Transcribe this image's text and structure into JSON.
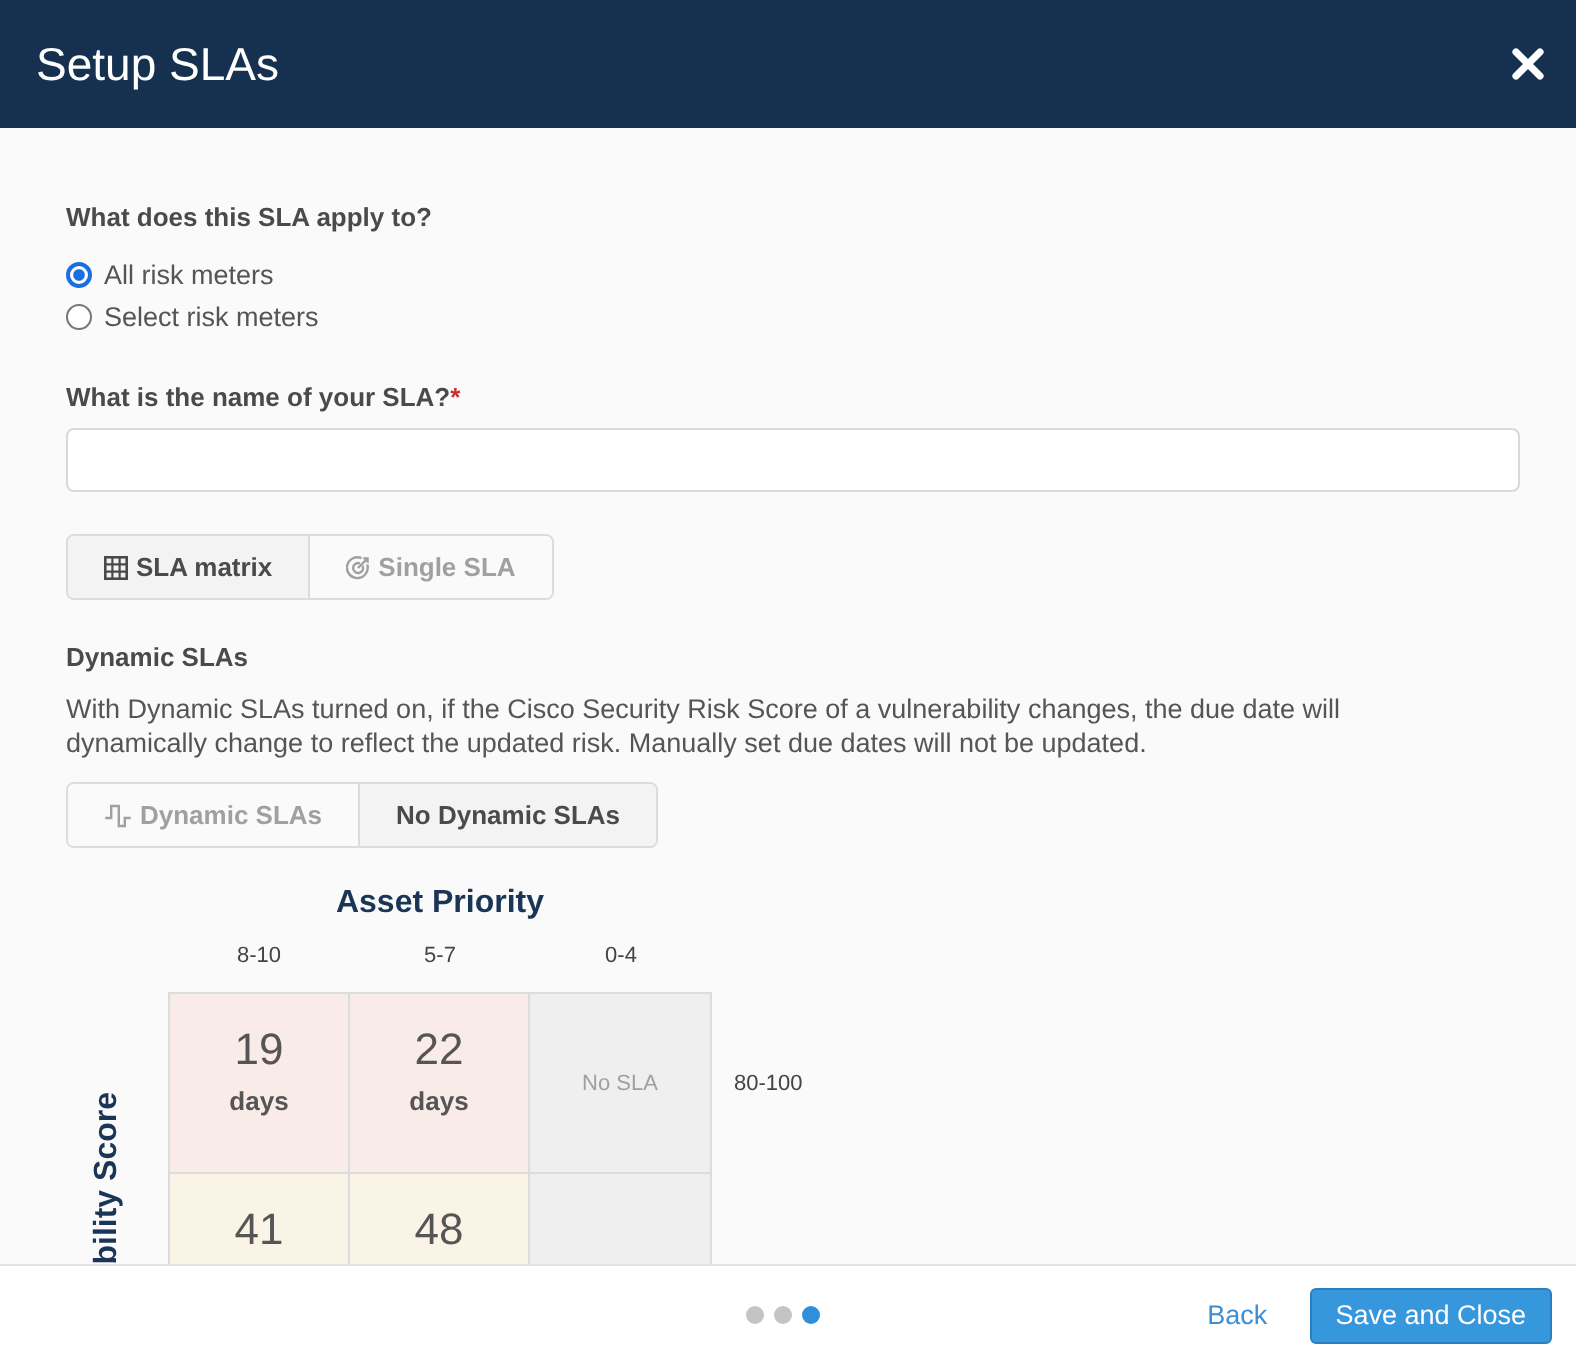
{
  "dialog": {
    "title": "Setup SLAs"
  },
  "apply_to": {
    "label": "What does this SLA apply to?",
    "options": [
      {
        "label": "All risk meters",
        "selected": true
      },
      {
        "label": "Select risk meters",
        "selected": false
      }
    ]
  },
  "sla_name": {
    "label": "What is the name of your SLA?",
    "required_mark": "*"
  },
  "sla_type": [
    {
      "label": "SLA matrix",
      "selected": true
    },
    {
      "label": "Single SLA",
      "selected": false
    }
  ],
  "dynamic_slas": {
    "title": "Dynamic SLAs",
    "description": "With Dynamic SLAs turned on, if the Cisco Security Risk Score of a vulnerability changes, the due date will dynamically change to reflect the updated risk. Manually set due dates will not be updated.",
    "options": [
      {
        "label": "Dynamic SLAs",
        "selected": false
      },
      {
        "label": "No Dynamic SLAs",
        "selected": true
      }
    ]
  },
  "matrix": {
    "column_axis": "Asset Priority",
    "row_axis": "bility Score",
    "columns": [
      "8-10",
      "5-7",
      "0-4"
    ],
    "rows": [
      {
        "label": "80-100",
        "cells": [
          {
            "kind": "days",
            "value": "19",
            "unit": "days",
            "color": "#f9ebe8"
          },
          {
            "kind": "days",
            "value": "22",
            "unit": "days",
            "color": "#f9ebe8"
          },
          {
            "kind": "none",
            "text": "No SLA",
            "color": "#efefef"
          }
        ]
      },
      {
        "cells": [
          {
            "kind": "days",
            "value": "41",
            "color": "#faf4e6"
          },
          {
            "kind": "days",
            "value": "48",
            "color": "#faf4e6"
          },
          {
            "kind": "none",
            "color": "#efefef"
          }
        ]
      }
    ]
  },
  "footer": {
    "steps": [
      {
        "selected": false
      },
      {
        "selected": false
      },
      {
        "selected": true
      }
    ],
    "back": "Back",
    "save": "Save and Close"
  }
}
